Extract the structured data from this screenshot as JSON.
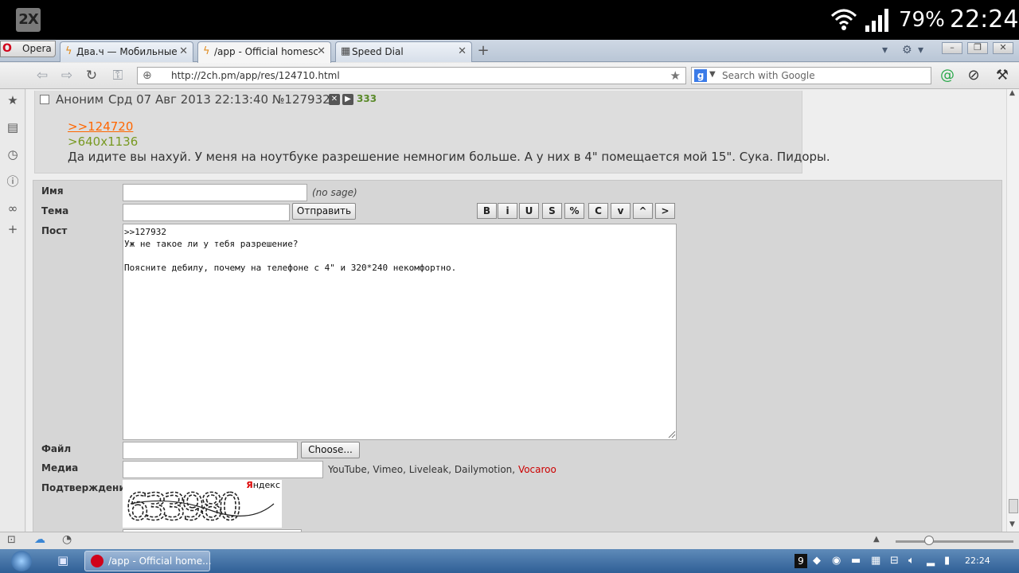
{
  "status_bar": {
    "badge": "2X",
    "battery": "79%",
    "time": "22:24"
  },
  "browser": {
    "menu_label": "Opera",
    "tabs": [
      {
        "label": "Два.ч — Мобильные ...",
        "icon": "bolt-icon"
      },
      {
        "label": "/app - Official homescr...",
        "icon": "bolt-icon"
      },
      {
        "label": "Speed Dial",
        "icon": "grid-icon"
      }
    ],
    "url": "http://2ch.pm/app/res/124710.html",
    "search_placeholder": "Search with Google"
  },
  "post": {
    "author": "Аноним",
    "date": "Срд 07 Авг 2013 22:13:40 №127932",
    "count": "333",
    "reflink": ">>124720",
    "quote": ">640x1136",
    "message": "Да идите вы нахуй. У меня на ноутбуке разрешение немногим больше. А у них в 4\" помещается мой 15\". Сука. Пидоры."
  },
  "form": {
    "name_label": "Имя",
    "name_note": "(no sage)",
    "subject_label": "Тема",
    "submit_label": "Отправить",
    "markup_buttons": [
      "B",
      "i",
      "U",
      "S",
      "%",
      "C",
      "v",
      "^",
      ">"
    ],
    "post_label": "Пост",
    "post_text": ">>127932\nУж не такое ли у тебя разрешение?\n\nПоясните дебилу, почему на телефоне с 4\" и 320*240 некомфортно.",
    "file_label": "Файл",
    "choose_label": "Choose...",
    "media_label": "Медиа",
    "media_services": "YouTube, Vimeo, Liveleak, Dailymotion,",
    "media_vocaroo": "Vocaroo",
    "captcha_label": "Подтверждение",
    "captcha_brand_first": "Я",
    "captcha_brand_rest": "ндекс",
    "captcha_text": "633980"
  },
  "taskbar": {
    "task_label": "/app - Official home...",
    "tray_number": "9",
    "clock": "22:24"
  },
  "colors": {
    "reflink": "#ff6600",
    "quote": "#789922",
    "vocaroo": "#cc0000"
  }
}
